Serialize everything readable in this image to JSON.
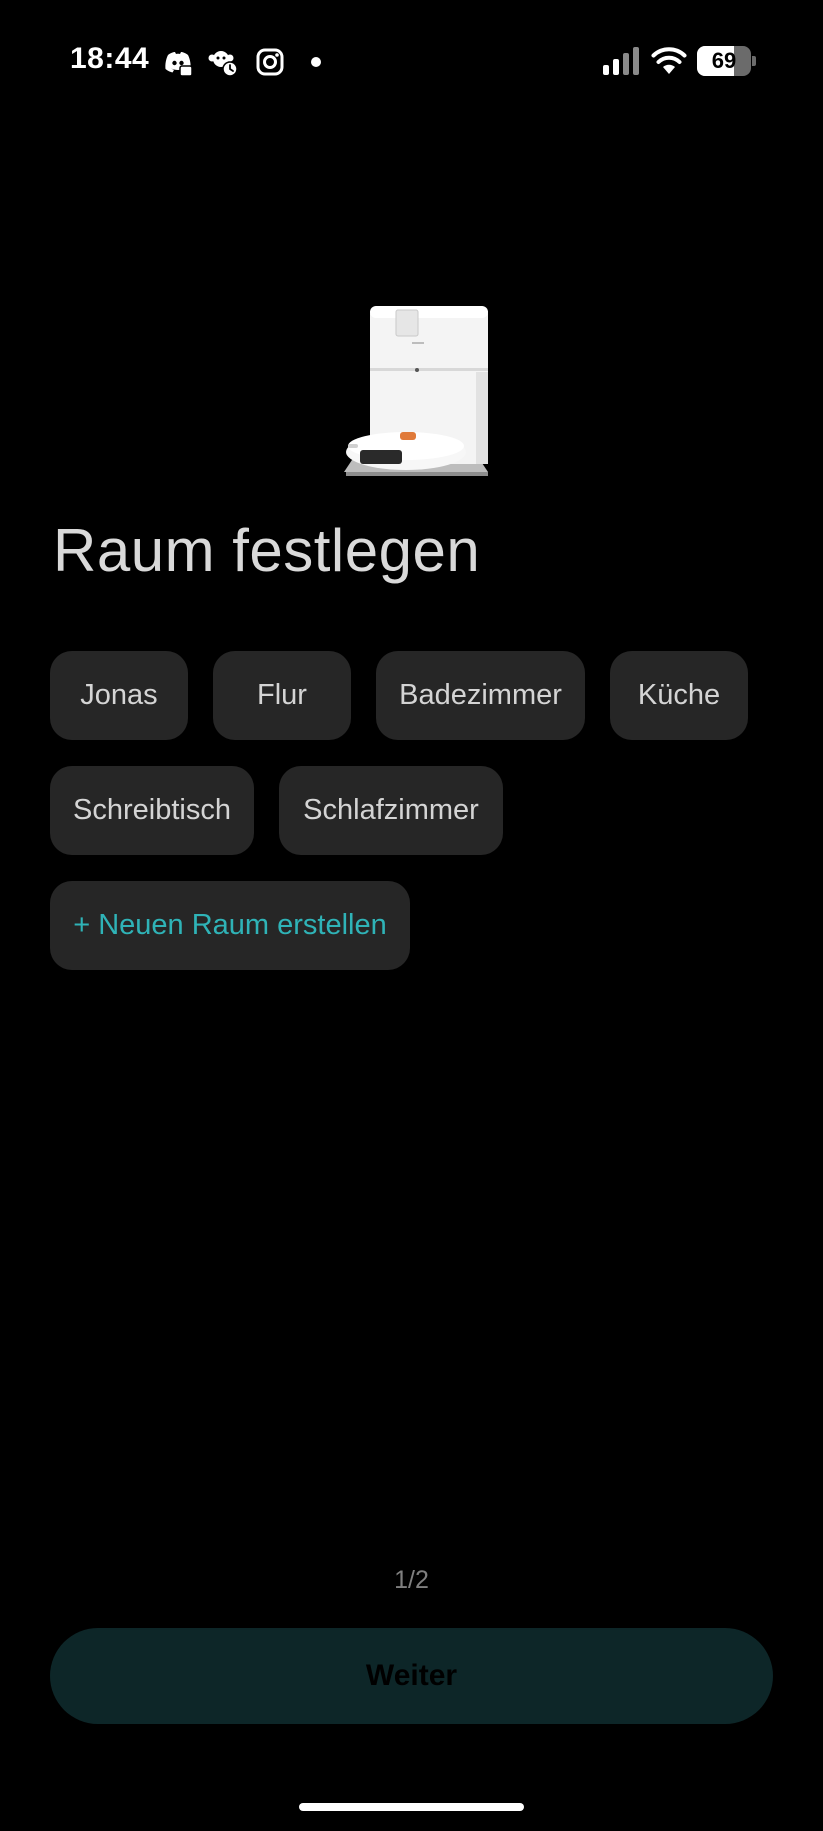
{
  "status_bar": {
    "time": "18:44",
    "battery_level": "69",
    "battery_fraction": 0.69,
    "notification_icons": [
      "discord-icon",
      "monkey-timer-icon",
      "instagram-icon"
    ]
  },
  "main": {
    "title": "Raum festlegen",
    "device_image": "robot-vacuum-with-dock-icon",
    "room_rows": [
      [
        "Jonas",
        "Flur",
        "Badezimmer",
        "Küche"
      ],
      [
        "Schreibtisch",
        "Schlafzimmer"
      ]
    ],
    "create_room_label": "+ Neuen Raum erstellen"
  },
  "footer": {
    "page_indicator": "1/2",
    "next_label": "Weiter"
  },
  "colors": {
    "background": "#000000",
    "chip_background": "#262626",
    "accent": "#2fb3b7",
    "next_button_background": "#0d2628"
  }
}
